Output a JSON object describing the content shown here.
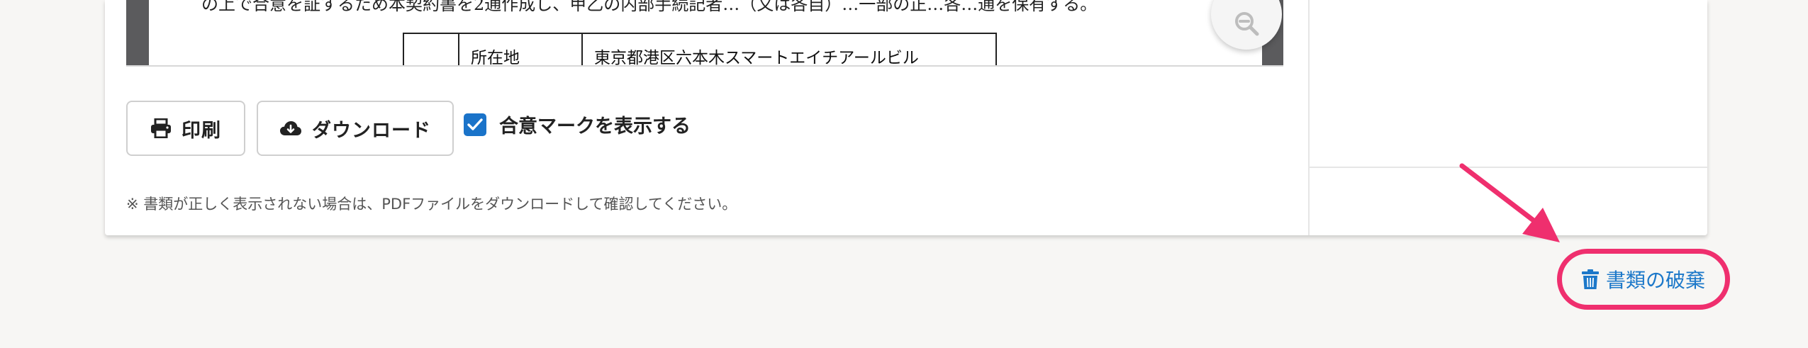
{
  "document": {
    "cut_text": "の上で合意を証するため本契約書を2通作成し、甲乙の内部手続記者…（又は各自）…一部の正…各…通を保有する。",
    "table": {
      "blank": "",
      "key": "所在地",
      "value": "東京都港区六本木スマートエイチアールビル"
    },
    "zoom_out_icon": "zoom-out-icon"
  },
  "toolbar": {
    "print_label": "印刷",
    "print_icon": "printer-icon",
    "download_label": "ダウンロード",
    "download_icon": "cloud-download-icon",
    "agree_label": "合意マークを表示する",
    "agree_checked": true
  },
  "note": "※ 書類が正しく表示されない場合は、PDFファイルをダウンロードして確認してください。",
  "actions": {
    "discard_label": "書類の破棄",
    "discard_icon": "trash-icon"
  },
  "colors": {
    "accent_blue": "#1a73c9",
    "link_blue": "#1c78c9",
    "highlight_pink": "#ef2f6e",
    "page_background": "#f7f6f4"
  }
}
